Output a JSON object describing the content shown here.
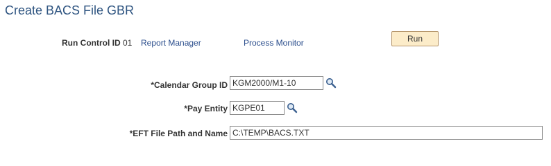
{
  "page": {
    "title": "Create BACS File GBR"
  },
  "run_control": {
    "label": "Run Control ID",
    "value": "01",
    "report_manager_link": "Report Manager",
    "process_monitor_link": "Process Monitor",
    "run_button": "Run"
  },
  "fields": {
    "calendar_group": {
      "label": "*Calendar Group ID",
      "value": "KGM2000/M1-10",
      "icon": "search-icon"
    },
    "pay_entity": {
      "label": "*Pay Entity",
      "value": "KGPE01",
      "icon": "search-icon"
    },
    "eft_path": {
      "label": "*EFT File Path and Name",
      "value": "C:\\TEMP\\BACS.TXT"
    }
  },
  "colors": {
    "title": "#2f5581",
    "link": "#2a4d8c",
    "button_bg": "#fcecc9",
    "button_border": "#b5956a"
  }
}
